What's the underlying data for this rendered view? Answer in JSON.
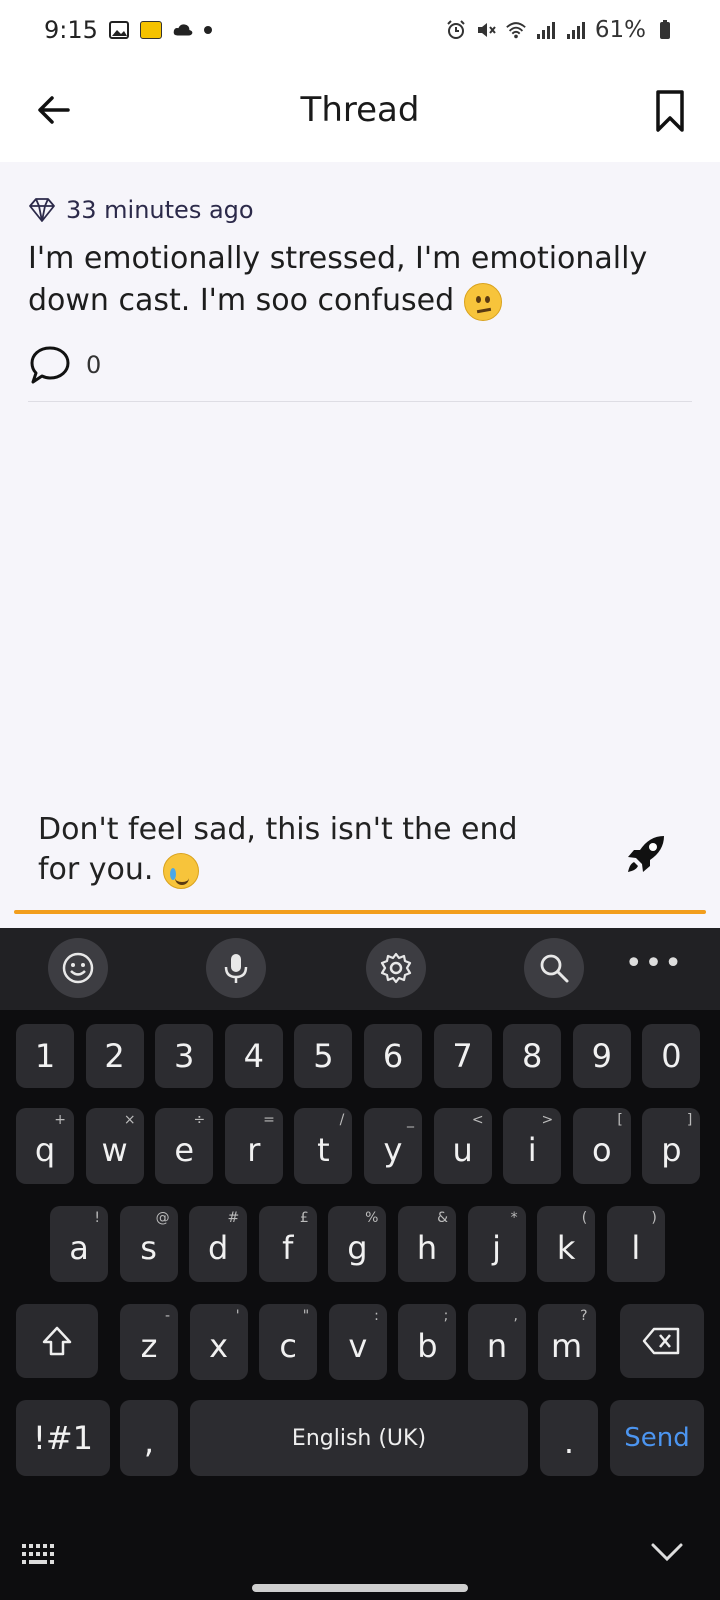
{
  "status_bar": {
    "time": "9:15",
    "battery": "61%"
  },
  "header": {
    "title": "Thread"
  },
  "post": {
    "time_ago": "33 minutes ago",
    "text": "I'm emotionally stressed, I'm emotionally down cast. I'm soo confused",
    "comment_count": "0"
  },
  "composer": {
    "value": "Don't feel sad, this isn't the end for you.",
    "accent_color": "#f29e1c"
  },
  "keyboard": {
    "number_row": [
      "1",
      "2",
      "3",
      "4",
      "5",
      "6",
      "7",
      "8",
      "9",
      "0"
    ],
    "row1": [
      {
        "key": "q",
        "alt": "+"
      },
      {
        "key": "w",
        "alt": "×"
      },
      {
        "key": "e",
        "alt": "÷"
      },
      {
        "key": "r",
        "alt": "="
      },
      {
        "key": "t",
        "alt": "/"
      },
      {
        "key": "y",
        "alt": "_"
      },
      {
        "key": "u",
        "alt": "<"
      },
      {
        "key": "i",
        "alt": ">"
      },
      {
        "key": "o",
        "alt": "["
      },
      {
        "key": "p",
        "alt": "]"
      }
    ],
    "row2": [
      {
        "key": "a",
        "alt": "!"
      },
      {
        "key": "s",
        "alt": "@"
      },
      {
        "key": "d",
        "alt": "#"
      },
      {
        "key": "f",
        "alt": "£"
      },
      {
        "key": "g",
        "alt": "%"
      },
      {
        "key": "h",
        "alt": "&"
      },
      {
        "key": "j",
        "alt": "*"
      },
      {
        "key": "k",
        "alt": "("
      },
      {
        "key": "l",
        "alt": ")"
      }
    ],
    "row3": [
      {
        "key": "z",
        "alt": "-"
      },
      {
        "key": "x",
        "alt": "'"
      },
      {
        "key": "c",
        "alt": "\""
      },
      {
        "key": "v",
        "alt": ":"
      },
      {
        "key": "b",
        "alt": ";"
      },
      {
        "key": "n",
        "alt": ","
      },
      {
        "key": "m",
        "alt": "?"
      }
    ],
    "symbols_label": "!#1",
    "comma": ",",
    "space_label": "English (UK)",
    "period": ".",
    "send_label": "Send"
  }
}
